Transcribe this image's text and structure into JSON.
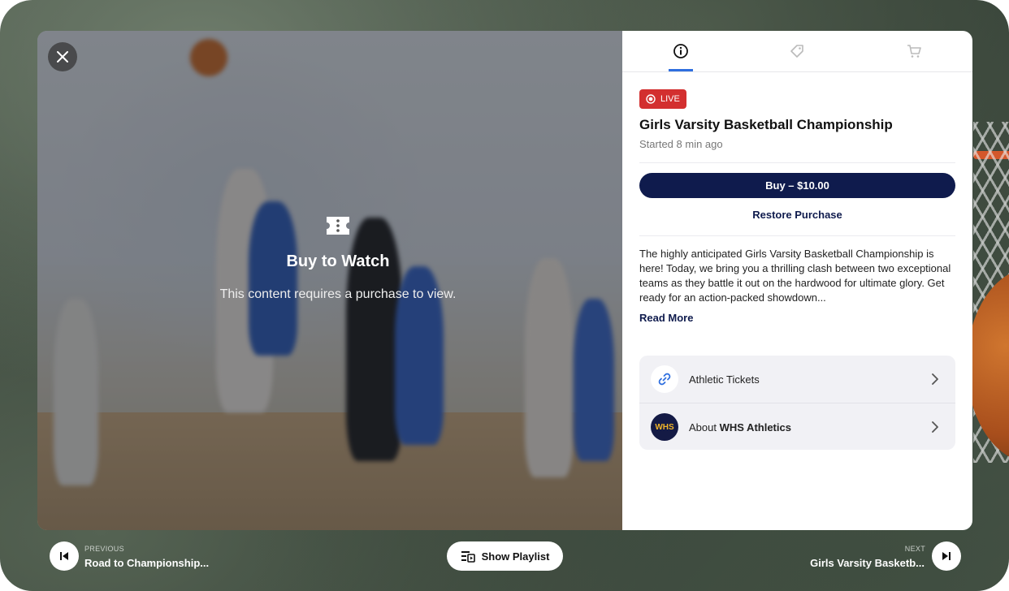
{
  "player": {
    "overlay_title": "Buy to Watch",
    "overlay_subtitle": "This content requires a purchase to view."
  },
  "tabs": [
    {
      "icon": "info-icon",
      "active": true
    },
    {
      "icon": "tag-icon",
      "active": false
    },
    {
      "icon": "cart-icon",
      "active": false
    }
  ],
  "event": {
    "badge": "LIVE",
    "title": "Girls Varsity Basketball Championship",
    "started": "Started 8 min ago",
    "buy_label": "Buy – $10.00",
    "restore_label": "Restore Purchase",
    "description": "The highly anticipated Girls Varsity Basketball Championship is here! Today, we bring you a thrilling clash between two exceptional teams as they battle it out on the hardwood for ultimate glory. Get ready for an action-packed showdown...",
    "read_more": "Read More"
  },
  "links": {
    "tickets_label": "Athletic Tickets",
    "about_prefix": "About ",
    "about_org": "WHS Athletics",
    "org_logo_text": "WHS"
  },
  "navigation": {
    "previous_caption": "PREVIOUS",
    "previous_title": "Road to Championship...",
    "next_caption": "NEXT",
    "next_title": "Girls Varsity Basketb...",
    "playlist_label": "Show Playlist"
  },
  "colors": {
    "primary": "#0f1b4d",
    "live": "#d32f2f",
    "tab_accent": "#2f6fdf",
    "link_blue": "#2f6fdf"
  }
}
